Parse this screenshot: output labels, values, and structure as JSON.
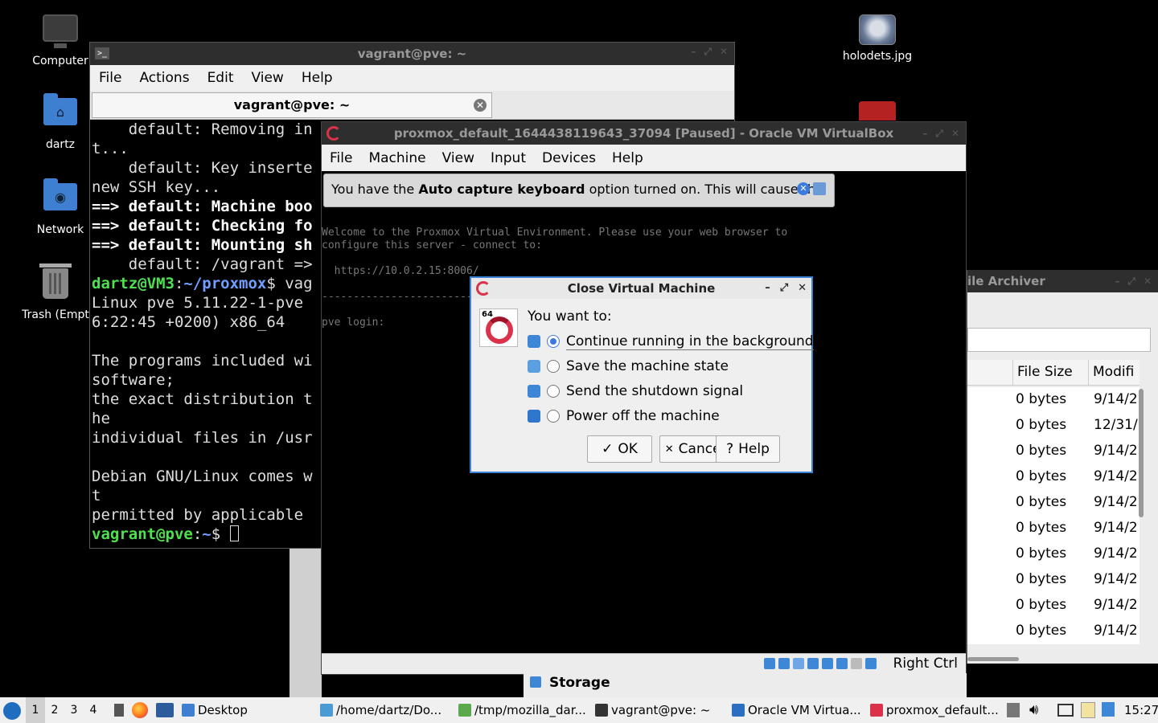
{
  "desktop": {
    "icons": [
      {
        "label": "Computer"
      },
      {
        "label": "dartz"
      },
      {
        "label": "Network"
      },
      {
        "label": "Trash (Empt"
      },
      {
        "label": "holodets.jpg"
      }
    ]
  },
  "terminal": {
    "title": "vagrant@pve: ~",
    "menu": [
      "File",
      "Actions",
      "Edit",
      "View",
      "Help"
    ],
    "tab_label": "vagrant@pve: ~",
    "lines": [
      {
        "text": "    default: Removing in",
        "style": "n"
      },
      {
        "text": "t...",
        "style": "n"
      },
      {
        "text": "    default: Key inserte",
        "style": "n"
      },
      {
        "text": "new SSH key...",
        "style": "n"
      },
      {
        "text": "==> default: Machine boo",
        "style": "b"
      },
      {
        "text": "==> default: Checking fo",
        "style": "b"
      },
      {
        "text": "==> default: Mounting sh",
        "style": "b"
      },
      {
        "text": "    default: /vagrant =>",
        "style": "n"
      },
      {
        "text": "",
        "style": "prompt1"
      },
      {
        "text": "Linux pve 5.11.22-1-pve",
        "style": "n"
      },
      {
        "text": "6:22:45 +0200) x86_64",
        "style": "n"
      },
      {
        "text": "",
        "style": "n"
      },
      {
        "text": "The programs included wi",
        "style": "n"
      },
      {
        "text": "software;",
        "style": "n"
      },
      {
        "text": "the exact distribution t",
        "style": "n"
      },
      {
        "text": "he",
        "style": "n"
      },
      {
        "text": "individual files in /usr",
        "style": "n"
      },
      {
        "text": "",
        "style": "n"
      },
      {
        "text": "Debian GNU/Linux comes w",
        "style": "n"
      },
      {
        "text": "t",
        "style": "n"
      },
      {
        "text": "permitted by applicable",
        "style": "n"
      },
      {
        "text": "",
        "style": "prompt2"
      }
    ],
    "prompt1": {
      "user": "dartz@VM3",
      "path": "~/proxmox",
      "cmd": "$ vag"
    },
    "prompt2": {
      "user": "vagrant@pve",
      "path": "~",
      "cmd": "$ "
    }
  },
  "archiver": {
    "title": "ile Archiver",
    "col_size": "File Size",
    "col_mod": "Modifi",
    "rows": [
      {
        "size": "0 bytes",
        "mod": "9/14/2"
      },
      {
        "size": "0 bytes",
        "mod": "12/31/"
      },
      {
        "size": "0 bytes",
        "mod": "9/14/2"
      },
      {
        "size": "0 bytes",
        "mod": "9/14/2"
      },
      {
        "size": "0 bytes",
        "mod": "9/14/2"
      },
      {
        "size": "0 bytes",
        "mod": "9/14/2"
      },
      {
        "size": "0 bytes",
        "mod": "9/14/2"
      },
      {
        "size": "0 bytes",
        "mod": "9/14/2"
      },
      {
        "size": "0 bytes",
        "mod": "9/14/2"
      },
      {
        "size": "0 bytes",
        "mod": "9/14/2"
      }
    ]
  },
  "vbox": {
    "title": "proxmox_default_1644438119643_37094 [Paused] - Oracle VM VirtualBox",
    "menu": [
      "File",
      "Machine",
      "View",
      "Input",
      "Devices",
      "Help"
    ],
    "notice_pre": "You have the ",
    "notice_bold": "Auto capture keyboard",
    "notice_post": " option turned on. This will cause the",
    "screen_lines": [
      "Welcome to the Proxmox Virtual Environment. Please use your web browser to",
      "configure this server - connect to:",
      "",
      "  https://10.0.2.15:8006/",
      "",
      "------------------------------------------------------------------------------",
      "",
      "pve login:"
    ],
    "host_key": "Right Ctrl",
    "storage_label": "Storage"
  },
  "dialog": {
    "title": "Close Virtual Machine",
    "badge": "64",
    "prompt": "You want to:",
    "options": [
      {
        "label": "Continue running in the background",
        "icon": "background-icon",
        "selected": true
      },
      {
        "label": "Save the machine state",
        "icon": "save-state-icon",
        "selected": false
      },
      {
        "label": "Send the shutdown signal",
        "icon": "shutdown-signal-icon",
        "selected": false
      },
      {
        "label": "Power off the machine",
        "icon": "power-off-icon",
        "selected": false
      }
    ],
    "ok": "OK",
    "cancel": "Cancel",
    "help": "Help"
  },
  "taskbar": {
    "workspaces": [
      "1",
      "2",
      "3",
      "4"
    ],
    "active_workspace": "1",
    "tasks": [
      {
        "label": "Desktop",
        "color": "#3f7fd1"
      },
      {
        "label": "/home/dartz/Do...",
        "color": "#4a9ad4"
      },
      {
        "label": "/tmp/mozilla_dar...",
        "color": "#5ca84c"
      },
      {
        "label": "vagrant@pve: ~",
        "color": "#333333"
      },
      {
        "label": "Oracle VM Virtua...",
        "color": "#2b6fc2"
      },
      {
        "label": "proxmox_default...",
        "color": "#d9324a"
      }
    ],
    "clock": "15:27"
  }
}
